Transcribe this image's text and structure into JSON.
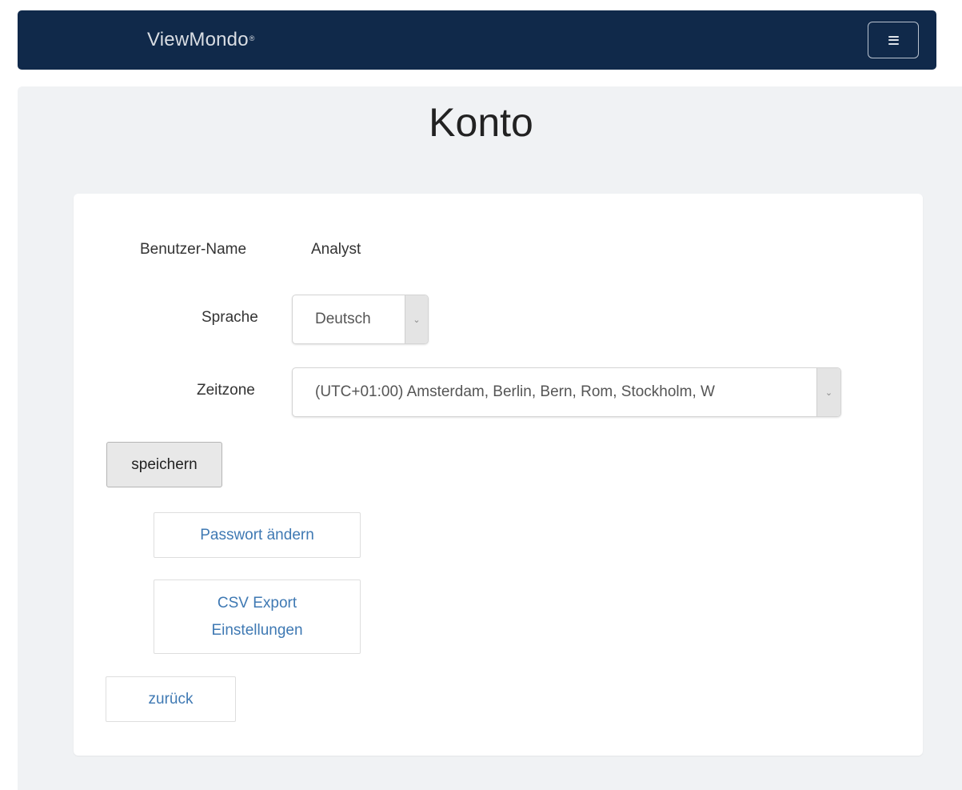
{
  "navbar": {
    "brand": "ViewMondo",
    "brand_mark": "®",
    "menu_icon": "hamburger-menu-icon"
  },
  "page": {
    "title": "Konto"
  },
  "form": {
    "username_label": "Benutzer-Name",
    "username_value": "Analyst",
    "language_label": "Sprache",
    "language_value": "Deutsch",
    "timezone_label": "Zeitzone",
    "timezone_value": "(UTC+01:00) Amsterdam, Berlin, Bern, Rom, Stockholm, W",
    "dropdown_icon": "chevron-down-icon",
    "save_label": "speichern"
  },
  "links": {
    "change_password": "Passwort ändern",
    "csv_export_line1": "CSV Export",
    "csv_export_line2": "Einstellungen",
    "back": "zurück"
  },
  "colors": {
    "navbar": "#10294a",
    "background": "#f0f2f4",
    "link": "#3f79b3"
  }
}
